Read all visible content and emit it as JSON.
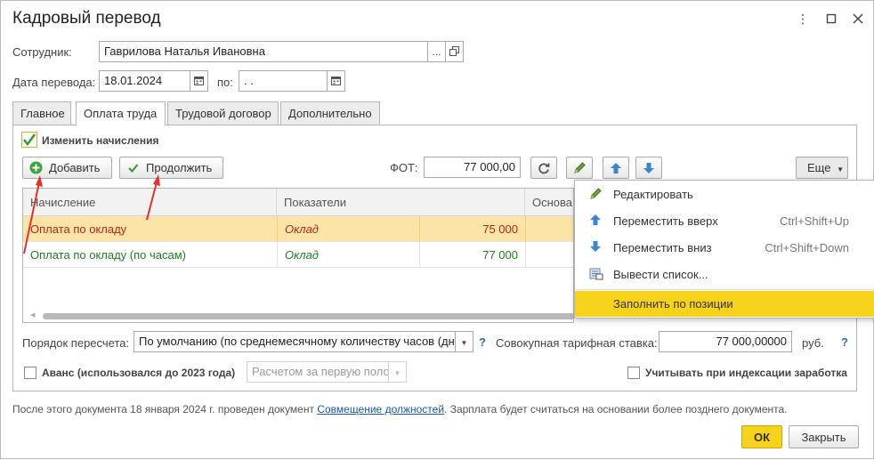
{
  "window": {
    "title": "Кадровый перевод",
    "menu_icon": "kebab-menu-icon",
    "maximize_icon": "maximize-icon",
    "close_icon": "close-icon"
  },
  "employee": {
    "label": "Сотрудник:",
    "value": "Гаврилова Наталья Ивановна",
    "select_button": "...",
    "open_icon": "open-link-icon"
  },
  "transfer_date": {
    "label": "Дата перевода:",
    "value": "18.01.2024",
    "to_label": "по:",
    "to_value": " .  .",
    "calendar_icon": "calendar-icon"
  },
  "tabs": [
    {
      "label": "Главное",
      "active": false
    },
    {
      "label": "Оплата труда",
      "active": true
    },
    {
      "label": "Трудовой договор",
      "active": false
    },
    {
      "label": "Дополнительно",
      "active": false
    }
  ],
  "payment": {
    "change_accruals_label": "Изменить начисления",
    "change_accruals_checked": true,
    "add_label": "Добавить",
    "continue_label": "Продолжить",
    "fot_label": "ФОТ:",
    "fot_value": "77 000,00",
    "more_label": "Еще",
    "columns": [
      "Начисление",
      "Показатели",
      "Основа"
    ],
    "rows": [
      {
        "accrual": "Оплата по окладу",
        "indicator": "Оклад",
        "amount": "75 000",
        "selected": true,
        "color": "#b0271b"
      },
      {
        "accrual": "Оплата по окладу (по часам)",
        "indicator": "Оклад",
        "amount": "77 000",
        "selected": false,
        "color": "#1e7d1e"
      }
    ],
    "recalc_label": "Порядок пересчета:",
    "recalc_value": "По умолчанию (по среднемесячному количеству часов (дн",
    "tariff_label": "Совокупная тарифная ставка:",
    "tariff_value": "77 000,00000",
    "currency": "руб.",
    "help_mark": "?",
    "advance_label": "Аванс (использовался до 2023 года)",
    "advance_checked": false,
    "advance_select": "Расчетом за первую поло",
    "indexation_label": "Учитывать при индексации заработка",
    "indexation_checked": false
  },
  "context_menu": {
    "items": [
      {
        "label": "Редактировать",
        "shortcut": "",
        "icon": "pencil-icon",
        "highlighted": false
      },
      {
        "label": "Переместить вверх",
        "shortcut": "Ctrl+Shift+Up",
        "icon": "arrow-up-icon",
        "highlighted": false
      },
      {
        "label": "Переместить вниз",
        "shortcut": "Ctrl+Shift+Down",
        "icon": "arrow-down-icon",
        "highlighted": false
      },
      {
        "label": "Вывести список...",
        "shortcut": "",
        "icon": "list-output-icon",
        "highlighted": false
      },
      {
        "label": "Заполнить по позиции",
        "shortcut": "",
        "icon": "",
        "highlighted": true
      }
    ]
  },
  "footer": {
    "note_before": "После этого документа 18 января 2024 г. проведен документ ",
    "note_link": "Совмещение должностей",
    "note_after": ". Зарплата будет считаться на основании более позднего документа.",
    "ok_label": "ОК",
    "close_label": "Закрыть"
  },
  "colors": {
    "accent_yellow": "#f6d21b",
    "row_selected": "#fbe4a6",
    "green_check": "#2e9a2e",
    "annotation_red": "#e0322b"
  }
}
